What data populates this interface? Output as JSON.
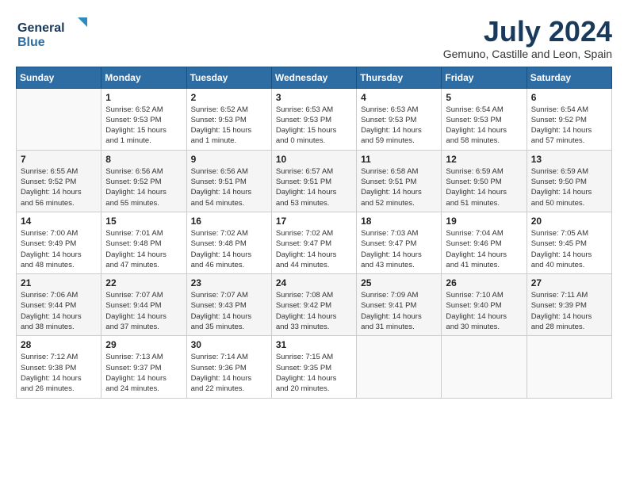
{
  "header": {
    "logo_line1": "General",
    "logo_line2": "Blue",
    "month": "July 2024",
    "location": "Gemuno, Castille and Leon, Spain"
  },
  "weekdays": [
    "Sunday",
    "Monday",
    "Tuesday",
    "Wednesday",
    "Thursday",
    "Friday",
    "Saturday"
  ],
  "weeks": [
    [
      {
        "day": "",
        "info": ""
      },
      {
        "day": "1",
        "info": "Sunrise: 6:52 AM\nSunset: 9:53 PM\nDaylight: 15 hours\nand 1 minute."
      },
      {
        "day": "2",
        "info": "Sunrise: 6:52 AM\nSunset: 9:53 PM\nDaylight: 15 hours\nand 1 minute."
      },
      {
        "day": "3",
        "info": "Sunrise: 6:53 AM\nSunset: 9:53 PM\nDaylight: 15 hours\nand 0 minutes."
      },
      {
        "day": "4",
        "info": "Sunrise: 6:53 AM\nSunset: 9:53 PM\nDaylight: 14 hours\nand 59 minutes."
      },
      {
        "day": "5",
        "info": "Sunrise: 6:54 AM\nSunset: 9:53 PM\nDaylight: 14 hours\nand 58 minutes."
      },
      {
        "day": "6",
        "info": "Sunrise: 6:54 AM\nSunset: 9:52 PM\nDaylight: 14 hours\nand 57 minutes."
      }
    ],
    [
      {
        "day": "7",
        "info": "Sunrise: 6:55 AM\nSunset: 9:52 PM\nDaylight: 14 hours\nand 56 minutes."
      },
      {
        "day": "8",
        "info": "Sunrise: 6:56 AM\nSunset: 9:52 PM\nDaylight: 14 hours\nand 55 minutes."
      },
      {
        "day": "9",
        "info": "Sunrise: 6:56 AM\nSunset: 9:51 PM\nDaylight: 14 hours\nand 54 minutes."
      },
      {
        "day": "10",
        "info": "Sunrise: 6:57 AM\nSunset: 9:51 PM\nDaylight: 14 hours\nand 53 minutes."
      },
      {
        "day": "11",
        "info": "Sunrise: 6:58 AM\nSunset: 9:51 PM\nDaylight: 14 hours\nand 52 minutes."
      },
      {
        "day": "12",
        "info": "Sunrise: 6:59 AM\nSunset: 9:50 PM\nDaylight: 14 hours\nand 51 minutes."
      },
      {
        "day": "13",
        "info": "Sunrise: 6:59 AM\nSunset: 9:50 PM\nDaylight: 14 hours\nand 50 minutes."
      }
    ],
    [
      {
        "day": "14",
        "info": "Sunrise: 7:00 AM\nSunset: 9:49 PM\nDaylight: 14 hours\nand 48 minutes."
      },
      {
        "day": "15",
        "info": "Sunrise: 7:01 AM\nSunset: 9:48 PM\nDaylight: 14 hours\nand 47 minutes."
      },
      {
        "day": "16",
        "info": "Sunrise: 7:02 AM\nSunset: 9:48 PM\nDaylight: 14 hours\nand 46 minutes."
      },
      {
        "day": "17",
        "info": "Sunrise: 7:02 AM\nSunset: 9:47 PM\nDaylight: 14 hours\nand 44 minutes."
      },
      {
        "day": "18",
        "info": "Sunrise: 7:03 AM\nSunset: 9:47 PM\nDaylight: 14 hours\nand 43 minutes."
      },
      {
        "day": "19",
        "info": "Sunrise: 7:04 AM\nSunset: 9:46 PM\nDaylight: 14 hours\nand 41 minutes."
      },
      {
        "day": "20",
        "info": "Sunrise: 7:05 AM\nSunset: 9:45 PM\nDaylight: 14 hours\nand 40 minutes."
      }
    ],
    [
      {
        "day": "21",
        "info": "Sunrise: 7:06 AM\nSunset: 9:44 PM\nDaylight: 14 hours\nand 38 minutes."
      },
      {
        "day": "22",
        "info": "Sunrise: 7:07 AM\nSunset: 9:44 PM\nDaylight: 14 hours\nand 37 minutes."
      },
      {
        "day": "23",
        "info": "Sunrise: 7:07 AM\nSunset: 9:43 PM\nDaylight: 14 hours\nand 35 minutes."
      },
      {
        "day": "24",
        "info": "Sunrise: 7:08 AM\nSunset: 9:42 PM\nDaylight: 14 hours\nand 33 minutes."
      },
      {
        "day": "25",
        "info": "Sunrise: 7:09 AM\nSunset: 9:41 PM\nDaylight: 14 hours\nand 31 minutes."
      },
      {
        "day": "26",
        "info": "Sunrise: 7:10 AM\nSunset: 9:40 PM\nDaylight: 14 hours\nand 30 minutes."
      },
      {
        "day": "27",
        "info": "Sunrise: 7:11 AM\nSunset: 9:39 PM\nDaylight: 14 hours\nand 28 minutes."
      }
    ],
    [
      {
        "day": "28",
        "info": "Sunrise: 7:12 AM\nSunset: 9:38 PM\nDaylight: 14 hours\nand 26 minutes."
      },
      {
        "day": "29",
        "info": "Sunrise: 7:13 AM\nSunset: 9:37 PM\nDaylight: 14 hours\nand 24 minutes."
      },
      {
        "day": "30",
        "info": "Sunrise: 7:14 AM\nSunset: 9:36 PM\nDaylight: 14 hours\nand 22 minutes."
      },
      {
        "day": "31",
        "info": "Sunrise: 7:15 AM\nSunset: 9:35 PM\nDaylight: 14 hours\nand 20 minutes."
      },
      {
        "day": "",
        "info": ""
      },
      {
        "day": "",
        "info": ""
      },
      {
        "day": "",
        "info": ""
      }
    ]
  ]
}
